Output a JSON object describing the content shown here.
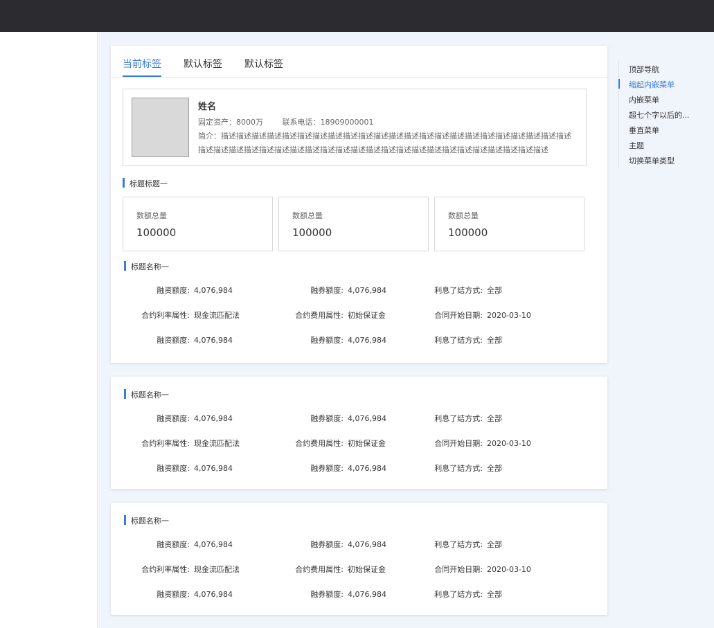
{
  "tabs": [
    "当前标签",
    "默认标签",
    "默认标签"
  ],
  "profile": {
    "name": "姓名",
    "assets_label": "固定资产：",
    "assets_value": "8000万",
    "phone_label": "联系电话：",
    "phone_value": "18909000001",
    "desc_label": "简介：",
    "desc_value": "描述描述描述描述描述描述描述描述描述描述描述描述描述描述描述描述描述描述描述描述描述描述描述描述描述描述描述描述描述描述描述描述描述描述描述描述描述描述描述描述描述描述描述描述描述描述"
  },
  "section1_title": "标题标题一",
  "stats": [
    {
      "label": "数额总量",
      "value": "100000"
    },
    {
      "label": "数额总量",
      "value": "100000"
    },
    {
      "label": "数额总量",
      "value": "100000"
    }
  ],
  "detail_title": "标题名称一",
  "detail_rows": [
    [
      {
        "label": "融资额度:",
        "value": "4,076,984"
      },
      {
        "label": "融券额度:",
        "value": "4,076,984"
      },
      {
        "label": "利息了结方式:",
        "value": "全部"
      }
    ],
    [
      {
        "label": "合约利率属性:",
        "value": "现金流匹配法"
      },
      {
        "label": "合约费用属性:",
        "value": "初始保证金"
      },
      {
        "label": "合同开始日期:",
        "value": "2020-03-10"
      }
    ],
    [
      {
        "label": "融资额度:",
        "value": "4,076,984"
      },
      {
        "label": "融券额度:",
        "value": "4,076,984"
      },
      {
        "label": "利息了结方式:",
        "value": "全部"
      }
    ]
  ],
  "anchor": {
    "items": [
      "顶部导航",
      "缩起内嵌菜单",
      "内嵌菜单",
      "超七个字以后的...",
      "垂直菜单",
      "主题",
      "切换菜单类型"
    ],
    "active_index": 1
  },
  "colors": {
    "accent": "#3a7be0",
    "topbar": "#2c2c30",
    "page_bg": "#f0f4fb"
  }
}
